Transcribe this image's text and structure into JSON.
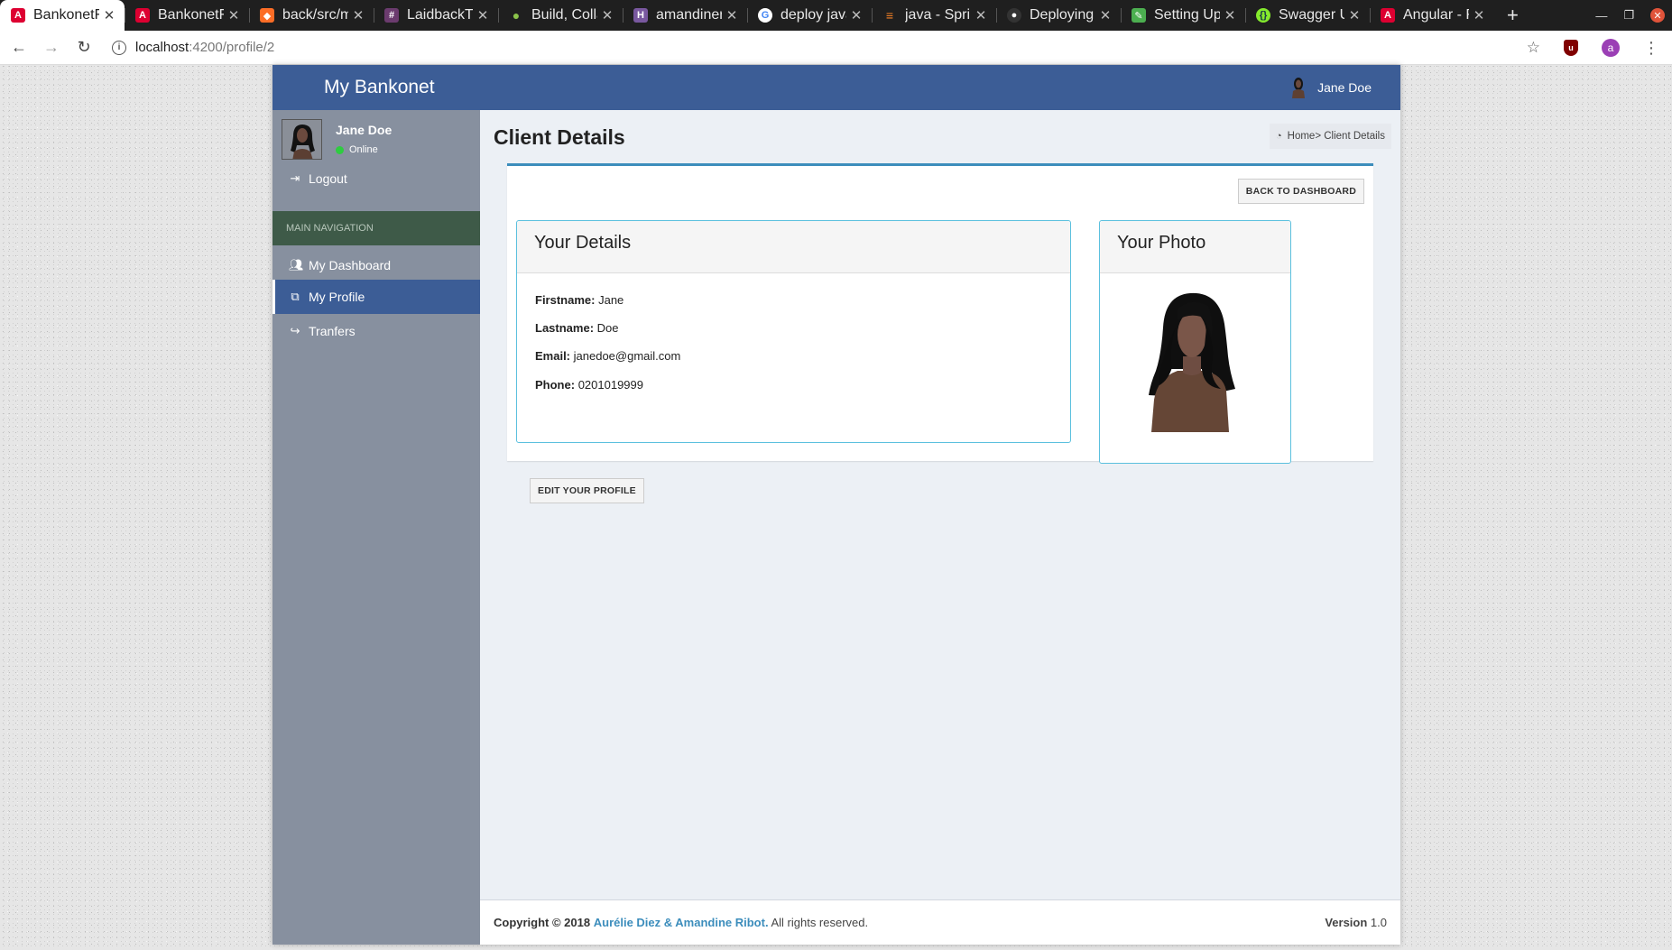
{
  "browser": {
    "tabs": [
      {
        "label": "BankonetF",
        "icon": "angular-icon",
        "color": "#dd0031",
        "active": true
      },
      {
        "label": "BankonetF",
        "icon": "angular-icon",
        "color": "#dd0031",
        "active": false
      },
      {
        "label": "back/src/m",
        "icon": "gitlab-icon",
        "color": "#fc6d26",
        "active": false
      },
      {
        "label": "LaidbackTl",
        "icon": "slack-icon",
        "color": "#6b3b6e",
        "active": false
      },
      {
        "label": "Build, Colla",
        "icon": "circle-icon",
        "color": "#8bc34a",
        "active": false
      },
      {
        "label": "amandiner",
        "icon": "heroku-icon",
        "color": "#79589f",
        "active": false
      },
      {
        "label": "deploy java",
        "icon": "google-icon",
        "color": "#4285f4",
        "active": false
      },
      {
        "label": "java - Sprin",
        "icon": "stackoverflow-icon",
        "color": "#f48024",
        "active": false
      },
      {
        "label": "Deploying",
        "icon": "github-icon",
        "color": "#333333",
        "active": false
      },
      {
        "label": "Setting Up",
        "icon": "leaf-icon",
        "color": "#4caf50",
        "active": false
      },
      {
        "label": "Swagger U",
        "icon": "swagger-icon",
        "color": "#85ea2d",
        "active": false
      },
      {
        "label": "Angular - R",
        "icon": "angular-icon",
        "color": "#dd0031",
        "active": false
      }
    ],
    "url_host": "localhost",
    "url_path": ":4200/profile/2",
    "profile_initial": "a"
  },
  "header": {
    "brand": "My Bankonet",
    "user_name": "Jane Doe"
  },
  "sidebar": {
    "user_name": "Jane Doe",
    "status": "Online",
    "logout": "Logout",
    "section_header": "MAIN NAVIGATION",
    "items": [
      {
        "label": "My Dashboard",
        "icon": "users-icon"
      },
      {
        "label": "My Profile",
        "icon": "profile-icon"
      },
      {
        "label": "Tranfers",
        "icon": "share-icon"
      }
    ]
  },
  "main": {
    "title": "Client Details",
    "breadcrumb": "Home> Client Details",
    "back_button": "BACK TO DASHBOARD",
    "details_title": "Your Details",
    "photo_title": "Your Photo",
    "edit_button": "EDIT YOUR PROFILE",
    "fields": [
      {
        "label": "Firstname:",
        "value": "Jane"
      },
      {
        "label": "Lastname:",
        "value": "Doe"
      },
      {
        "label": "Email:",
        "value": "janedoe@gmail.com"
      },
      {
        "label": "Phone:",
        "value": "0201019999"
      }
    ]
  },
  "footer": {
    "copyright": "Copyright © 2018",
    "authors": "Aurélie Diez & Amandine Ribot.",
    "rights": "All rights reserved.",
    "version_label": "Version",
    "version_value": "1.0"
  },
  "colors": {
    "primary": "#3c5d96",
    "sidebar": "#87909f",
    "section_header": "#3e5a48",
    "accent": "#3c8dbc",
    "panel_border": "#5bc0de"
  }
}
